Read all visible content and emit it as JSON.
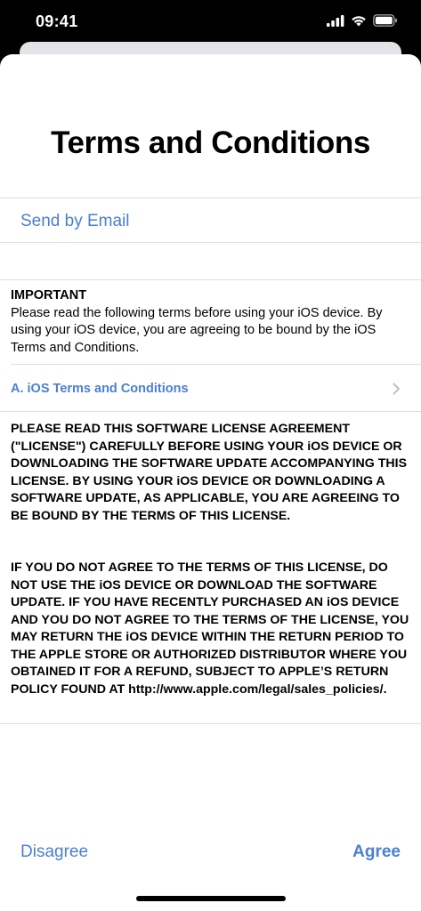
{
  "status_bar": {
    "time": "09:41"
  },
  "title": "Terms and Conditions",
  "send_email_label": "Send by Email",
  "important": {
    "heading": "IMPORTANT",
    "body": "Please read the following terms before using your iOS device. By using your iOS device, you are agreeing to be bound by the iOS Terms and Conditions."
  },
  "section": {
    "label": "A. iOS Terms and Conditions"
  },
  "legal_paragraphs": [
    "PLEASE READ THIS SOFTWARE LICENSE AGREEMENT (\"LICENSE\") CAREFULLY BEFORE USING YOUR iOS DEVICE OR DOWNLOADING THE SOFTWARE UPDATE ACCOMPANYING THIS LICENSE. BY USING YOUR iOS DEVICE OR DOWNLOADING A SOFTWARE UPDATE, AS APPLICABLE, YOU ARE AGREEING TO BE BOUND BY THE TERMS OF THIS LICENSE.",
    "IF YOU DO NOT AGREE TO THE TERMS OF THIS LICENSE, DO NOT USE THE iOS DEVICE OR DOWNLOAD THE SOFTWARE UPDATE. IF YOU HAVE RECENTLY PURCHASED AN iOS DEVICE AND YOU DO NOT AGREE TO THE TERMS OF THE LICENSE, YOU MAY RETURN THE iOS DEVICE WITHIN THE RETURN PERIOD TO THE APPLE STORE OR AUTHORIZED DISTRIBUTOR WHERE YOU OBTAINED IT FOR A REFUND, SUBJECT TO APPLE’S RETURN POLICY FOUND AT http://www.apple.com/legal/sales_policies/."
  ],
  "footer": {
    "disagree_label": "Disagree",
    "agree_label": "Agree"
  },
  "colors": {
    "accent": "#4a7fd0",
    "separator": "#dedee2",
    "background": "#ffffff"
  },
  "icons": [
    "cellular-signal-icon",
    "wifi-icon",
    "battery-icon",
    "chevron-right-icon"
  ]
}
